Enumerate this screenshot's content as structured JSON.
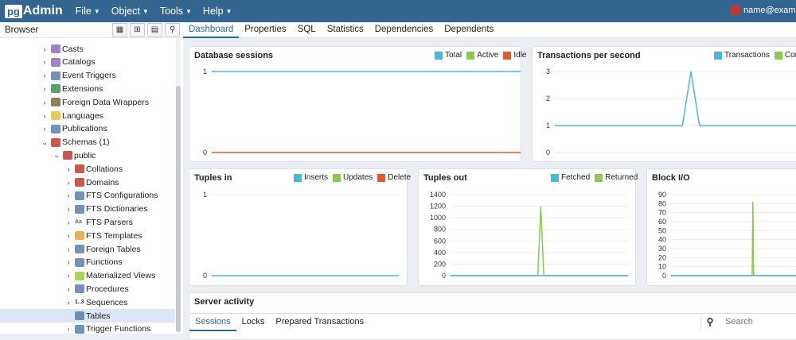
{
  "app": {
    "logo_pg": "pg",
    "logo_admin": "Admin"
  },
  "menu": [
    {
      "label": "File"
    },
    {
      "label": "Object"
    },
    {
      "label": "Tools"
    },
    {
      "label": "Help"
    }
  ],
  "user": {
    "email": "name@examp"
  },
  "browser": {
    "title": "Browser",
    "tools": [
      "db-icon",
      "grid-icon",
      "filter-icon",
      "search-icon"
    ]
  },
  "tree": [
    {
      "label": "Casts",
      "indent": 1,
      "icon_color": "#8e6bbf"
    },
    {
      "label": "Catalogs",
      "indent": 1,
      "icon_color": "#8e6bbf"
    },
    {
      "label": "Event Triggers",
      "indent": 1,
      "icon_color": "#5a7fa8"
    },
    {
      "label": "Extensions",
      "indent": 1,
      "icon_color": "#3f8f4a"
    },
    {
      "label": "Foreign Data Wrappers",
      "indent": 1,
      "icon_color": "#7a6a3a"
    },
    {
      "label": "Languages",
      "indent": 1,
      "icon_color": "#e2c13a"
    },
    {
      "label": "Publications",
      "indent": 1,
      "icon_color": "#5a7fa8"
    },
    {
      "label": "Schemas (1)",
      "indent": 1,
      "icon_color": "#c0392b",
      "expanded": true
    },
    {
      "label": "public",
      "indent": 2,
      "icon_color": "#c0392b",
      "expanded": true
    },
    {
      "label": "Collations",
      "indent": 3,
      "icon_color": "#c0392b"
    },
    {
      "label": "Domains",
      "indent": 3,
      "icon_color": "#c0392b"
    },
    {
      "label": "FTS Configurations",
      "indent": 3,
      "icon_color": "#5a7fa8"
    },
    {
      "label": "FTS Dictionaries",
      "indent": 3,
      "icon_color": "#5a7fa8"
    },
    {
      "label": "FTS Parsers",
      "indent": 3,
      "icon_color": "#7a6a3a",
      "icon_text": "Aa"
    },
    {
      "label": "FTS Templates",
      "indent": 3,
      "icon_color": "#e2a43a"
    },
    {
      "label": "Foreign Tables",
      "indent": 3,
      "icon_color": "#5a7fa8"
    },
    {
      "label": "Functions",
      "indent": 3,
      "icon_color": "#5a7fa8"
    },
    {
      "label": "Materialized Views",
      "indent": 3,
      "icon_color": "#9ccc3a"
    },
    {
      "label": "Procedures",
      "indent": 3,
      "icon_color": "#5a7fa8"
    },
    {
      "label": "Sequences",
      "indent": 3,
      "icon_color": "#333333",
      "icon_text": "1..3"
    },
    {
      "label": "Tables",
      "indent": 3,
      "icon_color": "#5a7fa8",
      "selected": true,
      "leaf": true
    },
    {
      "label": "Trigger Functions",
      "indent": 3,
      "icon_color": "#5a7fa8"
    }
  ],
  "tabs": [
    {
      "label": "Dashboard",
      "active": true
    },
    {
      "label": "Properties"
    },
    {
      "label": "SQL"
    },
    {
      "label": "Statistics"
    },
    {
      "label": "Dependencies"
    },
    {
      "label": "Dependents"
    }
  ],
  "colors": {
    "blue": "#4cb8d6",
    "green": "#8fc751",
    "orange": "#e0592a"
  },
  "chart_data": [
    {
      "id": "sessions",
      "type": "line",
      "title": "Database sessions",
      "legend": [
        "Total",
        "Active",
        "Idle"
      ],
      "y_ticks": [
        "1",
        "0"
      ],
      "ylim": [
        0,
        1
      ],
      "series": [
        {
          "name": "Total",
          "color": "#4cb8d6",
          "values": [
            1,
            1,
            1,
            1,
            1,
            1,
            1,
            1,
            1,
            1,
            1,
            1,
            1,
            1,
            1,
            1,
            1,
            1,
            1,
            1
          ]
        },
        {
          "name": "Idle",
          "color": "#e0592a",
          "values": [
            0,
            0,
            0,
            0,
            0,
            0,
            0,
            0,
            0,
            0,
            0,
            0,
            0,
            0,
            0,
            0,
            0,
            0,
            0,
            0
          ]
        }
      ]
    },
    {
      "id": "tps",
      "type": "line",
      "title": "Transactions per second",
      "legend": [
        "Transactions",
        "Com"
      ],
      "y_ticks": [
        "3",
        "2",
        "1",
        "0"
      ],
      "ylim": [
        0,
        3
      ],
      "series": [
        {
          "name": "Transactions",
          "color": "#4cb8d6",
          "values": [
            1,
            1,
            1,
            1,
            1,
            1,
            1,
            1,
            1,
            1,
            1,
            1,
            1,
            1,
            1,
            1,
            3,
            1,
            1,
            1,
            1,
            1,
            1,
            1,
            1,
            1,
            1,
            1,
            1,
            1
          ]
        }
      ]
    },
    {
      "id": "tuples_in",
      "type": "line",
      "title": "Tuples in",
      "legend": [
        "Inserts",
        "Updates",
        "Delete"
      ],
      "y_ticks": [
        "1",
        "0"
      ],
      "ylim": [
        0,
        1
      ],
      "series": [
        {
          "name": "Inserts",
          "color": "#4cb8d6",
          "values": [
            0,
            0,
            0,
            0,
            0,
            0,
            0,
            0,
            0,
            0,
            0,
            0,
            0,
            0,
            0,
            0,
            0,
            0,
            0,
            0
          ]
        }
      ]
    },
    {
      "id": "tuples_out",
      "type": "line",
      "title": "Tuples out",
      "legend": [
        "Fetched",
        "Returned"
      ],
      "y_ticks": [
        "1400",
        "1200",
        "1000",
        "800",
        "600",
        "400",
        "200",
        "0"
      ],
      "ylim": [
        0,
        1400
      ],
      "series": [
        {
          "name": "Returned",
          "color": "#8fc751",
          "values": [
            0,
            0,
            0,
            0,
            0,
            0,
            0,
            0,
            0,
            0,
            0,
            0,
            0,
            0,
            0,
            0,
            0,
            0,
            0,
            0,
            0,
            0,
            0,
            0,
            0,
            0,
            0,
            0,
            0,
            0,
            1200,
            0,
            0,
            0,
            0,
            0,
            0,
            0,
            0,
            0,
            0,
            0,
            0,
            0,
            0,
            0,
            0,
            0,
            0,
            0,
            0,
            0,
            0,
            0,
            0,
            0,
            0,
            0,
            0,
            0
          ]
        },
        {
          "name": "Fetched",
          "color": "#4cb8d6",
          "values": [
            0,
            0,
            0,
            0,
            0,
            0,
            0,
            0,
            0,
            0,
            0,
            0,
            0,
            0,
            0,
            0,
            0,
            0,
            0,
            0,
            0,
            0,
            0,
            0,
            0,
            0,
            0,
            0,
            0,
            0,
            0,
            0,
            0,
            0,
            0,
            0,
            0,
            0,
            0,
            0,
            0,
            0,
            0,
            0,
            0,
            0,
            0,
            0,
            0,
            0,
            0,
            0,
            0,
            0,
            0,
            0,
            0,
            0,
            0,
            0
          ]
        }
      ]
    },
    {
      "id": "block_io",
      "type": "line",
      "title": "Block I/O",
      "legend": [],
      "y_ticks": [
        "90",
        "80",
        "70",
        "60",
        "50",
        "40",
        "30",
        "20",
        "10",
        "0"
      ],
      "ylim": [
        0,
        90
      ],
      "series": [
        {
          "name": "",
          "color": "#8fc751",
          "values": [
            0,
            0,
            0,
            0,
            0,
            0,
            0,
            0,
            0,
            0,
            0,
            0,
            0,
            0,
            0,
            0,
            0,
            0,
            0,
            0,
            0,
            0,
            0,
            0,
            0,
            0,
            0,
            0,
            0,
            0,
            0,
            0,
            0,
            0,
            0,
            0,
            0,
            0,
            0,
            0,
            0,
            0,
            0,
            0,
            0,
            0,
            0,
            0,
            0,
            0,
            0,
            0,
            0,
            0,
            0,
            0,
            0,
            0,
            0,
            0,
            0,
            0,
            0,
            0,
            0,
            0,
            0,
            0,
            0,
            0,
            0,
            0,
            0,
            0,
            0,
            0,
            0,
            0,
            0,
            0,
            0,
            0,
            0,
            0,
            0,
            0,
            0,
            0,
            0,
            0,
            0,
            0,
            0,
            0,
            0,
            0,
            0,
            0,
            0,
            0,
            0,
            0,
            0,
            0,
            0,
            0,
            0,
            0,
            0,
            0,
            0,
            0,
            0,
            0,
            0,
            0,
            82,
            0,
            0,
            0,
            0,
            0,
            0,
            0,
            0,
            0,
            0,
            0,
            0,
            0,
            0,
            0,
            0,
            0,
            0,
            0,
            0,
            0,
            0,
            0,
            0,
            0,
            0,
            0,
            0,
            0,
            0,
            0,
            0,
            0,
            0,
            0,
            0,
            0,
            0,
            0,
            0,
            0,
            0,
            0,
            0,
            0,
            0,
            0,
            0,
            0,
            0,
            0,
            0,
            0,
            0,
            0,
            0,
            0,
            0,
            0,
            0,
            0,
            0,
            0,
            0,
            0,
            0,
            0,
            0,
            0
          ]
        },
        {
          "name": "",
          "color": "#4cb8d6",
          "values": [
            0,
            0,
            0,
            0,
            0,
            0,
            0,
            0,
            0,
            0,
            0,
            0,
            0,
            0,
            0,
            0,
            0,
            0,
            0,
            0
          ]
        }
      ]
    }
  ],
  "activity": {
    "title": "Server activity",
    "tabs": [
      {
        "label": "Sessions",
        "active": true
      },
      {
        "label": "Locks"
      },
      {
        "label": "Prepared Transactions"
      }
    ],
    "search_placeholder": "Search"
  }
}
